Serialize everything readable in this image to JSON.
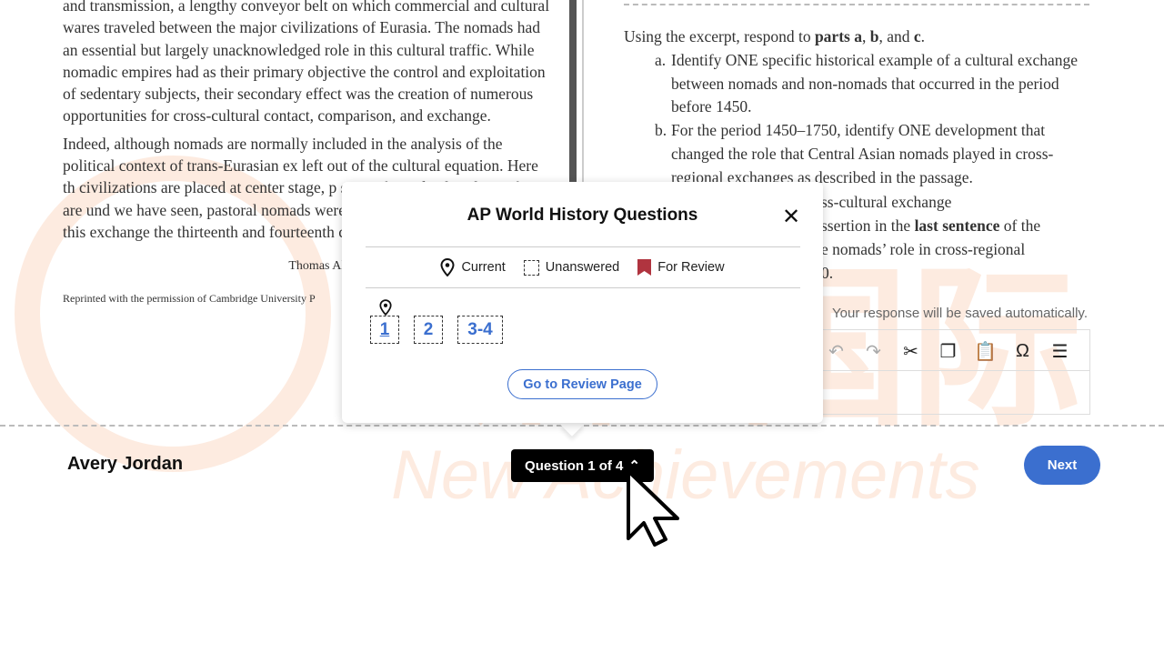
{
  "passage": {
    "paragraphs": [
      "and transmission, a lengthy conveyor belt on which commercial and cultural wares traveled between the major civilizations of Eurasia. The nomads had an essential but largely unacknowledged role in this cultural traffic. While nomadic empires had as their primary objective the control and exploitation of sedentary subjects, their secondary effect was the creation of numerous opportunities for cross-cultural contact, comparison, and exchange.",
      "Indeed, although nomads are normally included in the analysis of the political context of trans-Eurasian ex left out of the cultural equation. Here th civilizations are placed at center stage, p scientific and cultural transfers are und we have seen, pastoral nomads were the promoters, and agents of this exchange the thirteenth and fourteenth centuries]"
    ],
    "citation": "Thomas Allsen, hist",
    "reprint": "Reprinted with the permission of Cambridge University P"
  },
  "question": {
    "intro_pre": "Using the excerpt, respond to ",
    "intro_b1": "parts a",
    "intro_c1": ", ",
    "intro_b2": "b",
    "intro_c2": ", and ",
    "intro_b3": "c",
    "intro_end": ".",
    "items": [
      {
        "label": "a.",
        "text": "Identify ONE specific historical example of a cultural exchange between nomads and non-nomads that occurred in the period before 1450."
      },
      {
        "label": "b.",
        "text": "For the period 1450–1750, identify ONE development that changed the role that Central Asian nomads played in cross-regional exchanges as described in the passage."
      }
    ],
    "c_fragments": {
      "l1": "ss-cultural exchange",
      "l2_pre": "ssertion in the ",
      "l2_bold": "last sentence",
      "l2_post": " of the",
      "l3": "e nomads’ role in cross-regional",
      "l4": "0."
    }
  },
  "response": {
    "saved_note": "Your response will be saved automatically.",
    "toolbar": [
      "undo-icon",
      "redo-icon",
      "cut-icon",
      "copy-icon",
      "paste-icon",
      "omega-icon",
      "indent-icon"
    ]
  },
  "popup": {
    "title": "AP World History Questions",
    "legend": {
      "current": "Current",
      "unanswered": "Unanswered",
      "for_review": "For Review"
    },
    "questions": [
      "1",
      "2",
      "3-4"
    ],
    "current_question": "1",
    "review_button": "Go to Review Page"
  },
  "footer": {
    "student_name": "Avery Jordan",
    "question_nav": "Question 1 of 4",
    "next": "Next"
  },
  "watermark": {
    "chinese": "新橙国际",
    "english": "New Achievements"
  },
  "colors": {
    "accent": "#3b6fcf",
    "review_flag": "#b0343f",
    "watermark": "#f26b1d"
  }
}
